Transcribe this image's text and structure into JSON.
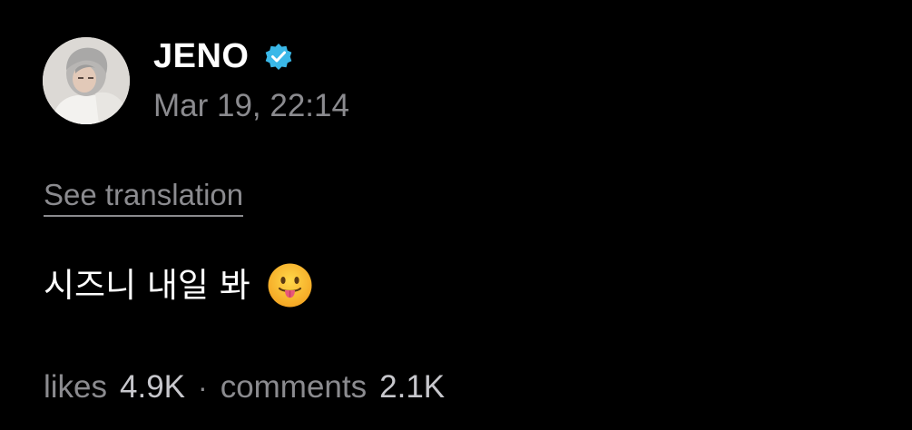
{
  "post": {
    "author": "JENO",
    "verified_icon": "verified-badge-icon",
    "avatar_icon": "avatar-image",
    "date": "Mar 19, 22:14",
    "translate_label": "See translation",
    "text": "시즈니 내일 봐",
    "emoji_icon": "tongue-out-face-icon"
  },
  "stats": {
    "likes_label": "likes",
    "likes_value": "4.9K",
    "separator": "·",
    "comments_label": "comments",
    "comments_value": "2.1K"
  },
  "colors": {
    "background": "#000000",
    "text_primary": "#ffffff",
    "text_secondary": "#8b8b8f",
    "verified_badge": "#3ab8e8"
  }
}
